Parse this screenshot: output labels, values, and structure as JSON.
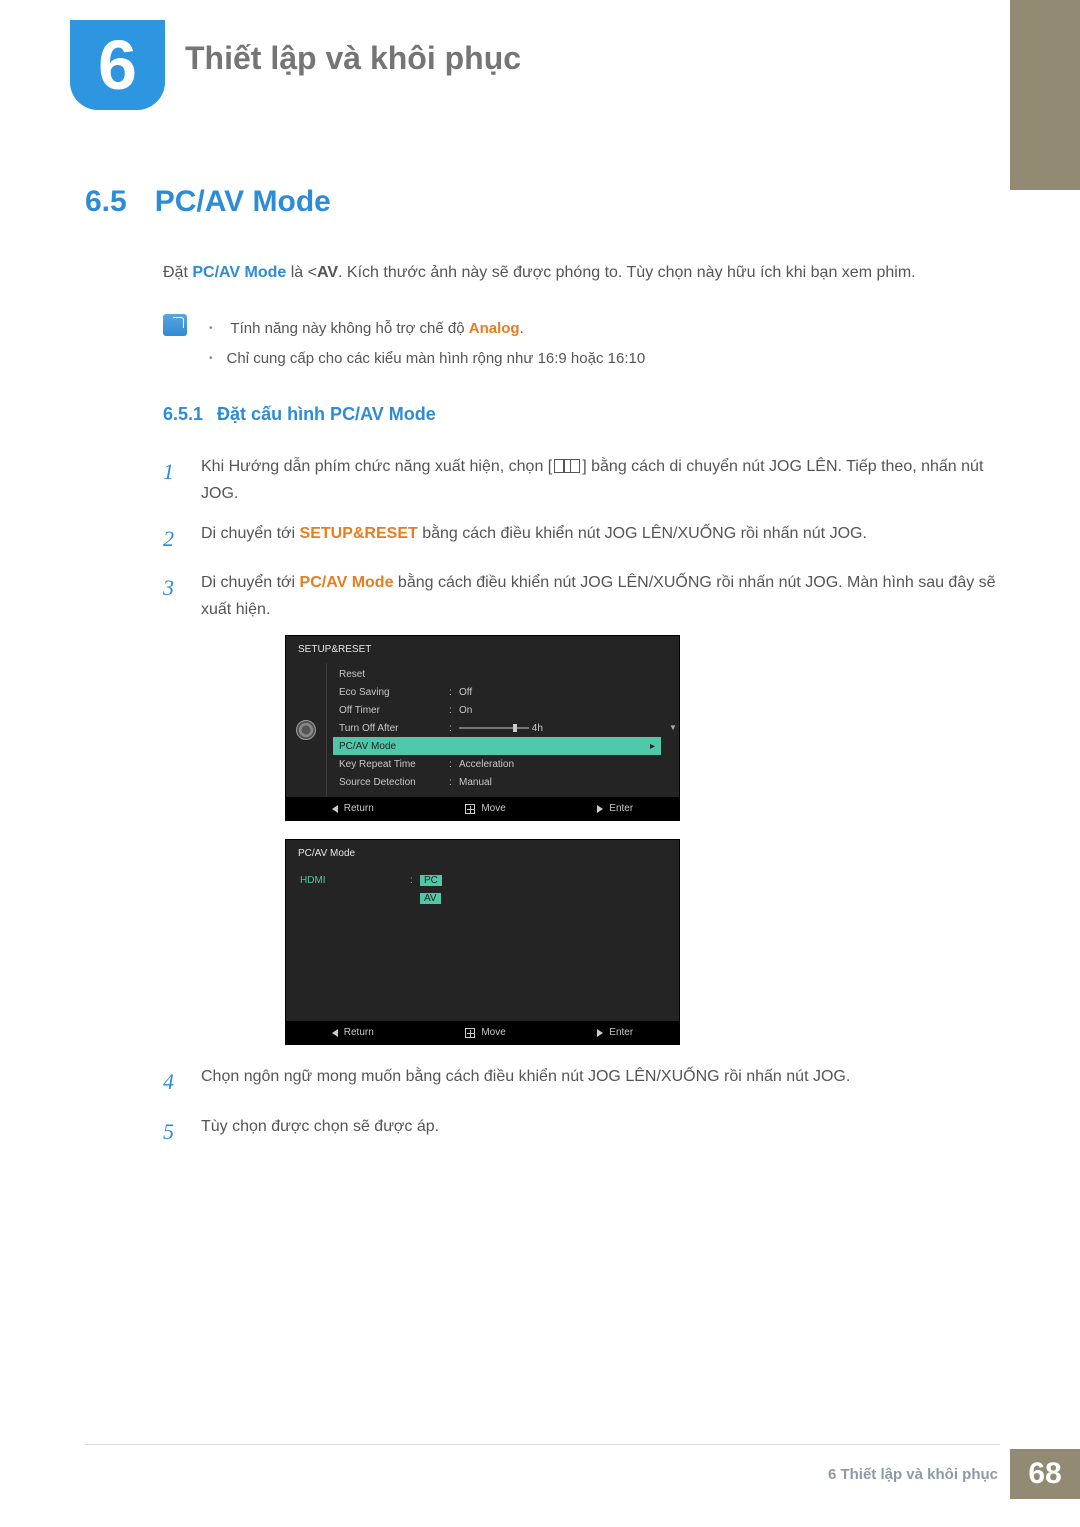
{
  "chapter": {
    "number": "6",
    "title": "Thiết lập và khôi phục"
  },
  "section": {
    "number": "6.5",
    "title": "PC/AV Mode"
  },
  "intro": {
    "pre": "Đặt ",
    "bold1": "PC/AV Mode",
    "mid": " là <",
    "bold2": "AV",
    "post": ". Kích thước ảnh này sẽ được phóng to. Tùy chọn này hữu ích khi bạn xem phim."
  },
  "notes": {
    "n1a": "Tính năng này không hỗ trợ chế độ ",
    "n1b": "Analog",
    "n1c": ".",
    "n2": "Chỉ cung cấp cho các kiểu màn hình rộng như 16:9 hoặc 16:10"
  },
  "subsection": {
    "number": "6.5.1",
    "title": "Đặt cấu hình PC/AV Mode"
  },
  "steps": {
    "s1": {
      "n": "1",
      "a": "Khi Hướng dẫn phím chức năng xuất hiện, chọn [",
      "b": "] bằng cách di chuyển nút JOG LÊN. Tiếp theo, nhấn nút JOG."
    },
    "s2": {
      "n": "2",
      "a": "Di chuyển tới ",
      "b": "SETUP&RESET",
      "c": " bằng cách điều khiển nút JOG LÊN/XUỐNG rồi nhấn nút JOG."
    },
    "s3": {
      "n": "3",
      "a": "Di chuyển tới ",
      "b": "PC/AV Mode",
      "c": " bằng cách điều khiển nút JOG LÊN/XUỐNG rồi nhấn nút JOG. Màn hình sau đây sẽ xuất hiện."
    },
    "s4": {
      "n": "4",
      "a": "Chọn ngôn ngữ mong muốn bằng cách điều khiển nút JOG LÊN/XUỐNG rồi nhấn nút JOG."
    },
    "s5": {
      "n": "5",
      "a": "Tùy chọn được chọn sẽ được áp."
    }
  },
  "osd1": {
    "header": "SETUP&RESET",
    "rows": {
      "reset": {
        "label": "Reset",
        "value": ""
      },
      "eco": {
        "label": "Eco Saving",
        "value": "Off"
      },
      "timer": {
        "label": "Off Timer",
        "value": "On"
      },
      "turn": {
        "label": "Turn Off After",
        "value": "4h"
      },
      "pcav": {
        "label": "PC/AV Mode",
        "value": ""
      },
      "key": {
        "label": "Key Repeat Time",
        "value": "Acceleration"
      },
      "src": {
        "label": "Source Detection",
        "value": "Manual"
      }
    },
    "footer": {
      "return": "Return",
      "move": "Move",
      "enter": "Enter"
    }
  },
  "osd2": {
    "header": "PC/AV Mode",
    "hdmi": "HDMI",
    "pc": "PC",
    "av": "AV",
    "footer": {
      "return": "Return",
      "move": "Move",
      "enter": "Enter"
    }
  },
  "footer": {
    "text": "6 Thiết lập và khôi phục",
    "page": "68"
  }
}
